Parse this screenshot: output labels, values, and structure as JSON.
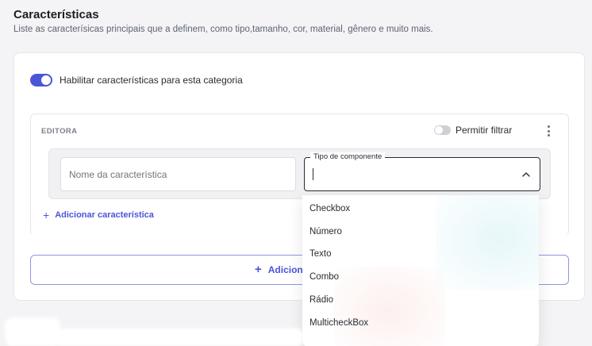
{
  "section": {
    "title": "Características",
    "subtitle": "Liste as caracterísicas principais que a definem, como tipo,tamanho, cor, material, gênero e muito mais."
  },
  "enable_toggle": {
    "label": "Habilitar características para esta categoria",
    "checked": true
  },
  "editor": {
    "label": "EDITORA",
    "filter_label": "Permitir filtrar",
    "filter_checked": false,
    "name_placeholder": "Nome da característica",
    "component_type_label": "Tipo de componente",
    "component_type_value": "",
    "add_feature_label": "Adicionar característica"
  },
  "add_button": {
    "label": "Adicion"
  },
  "dropdown": {
    "options": [
      "Checkbox",
      "Número",
      "Texto",
      "Combo",
      "Rádio",
      "MulticheckBox"
    ]
  },
  "colors": {
    "accent": "#4b55d8",
    "border": "#e6e6ea",
    "text": "#2b2b33"
  }
}
